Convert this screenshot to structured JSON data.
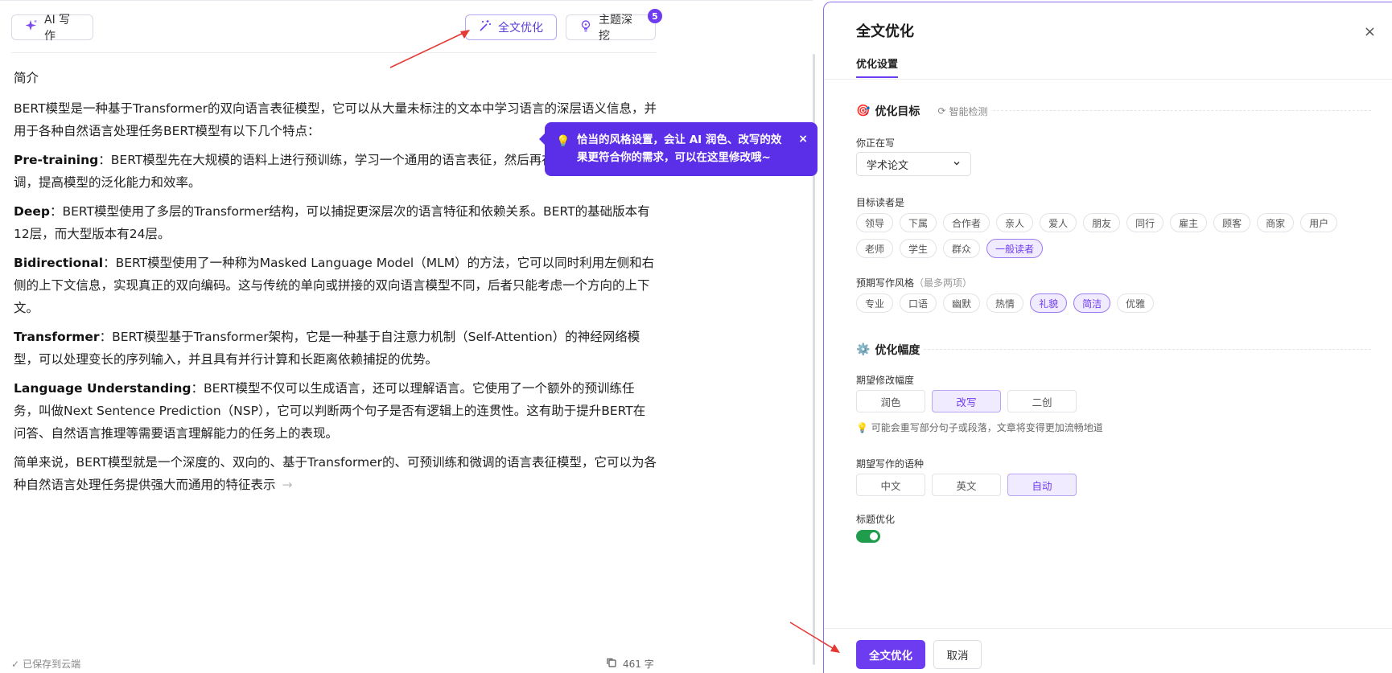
{
  "colors": {
    "accent": "#6d3bf0",
    "tooltip": "#5b2ee8",
    "toggle_on": "#1f9d4c",
    "annotation_arrow": "#e53935"
  },
  "toolbar": {
    "ai_write_label": "AI 写作",
    "optimize_label": "全文优化",
    "topic_label": "主题深挖",
    "topic_badge": "5"
  },
  "article": {
    "heading": "简介",
    "intro": "BERT模型是一种基于Transformer的双向语言表征模型，它可以从大量未标注的文本中学习语言的深层语义信息，并用于各种自然语言处理任务BERT模型有以下几个特点：",
    "items": [
      {
        "term": "Pre-training",
        "text": "：BERT模型先在大规模的语料上进行预训练，学习一个通用的语言表征，然后再在特定任务上进行微调，提高模型的泛化能力和效率。"
      },
      {
        "term": "Deep",
        "text": "：BERT模型使用了多层的Transformer结构，可以捕捉更深层次的语言特征和依赖关系。BERT的基础版本有12层，而大型版本有24层。"
      },
      {
        "term": "Bidirectional",
        "text": "：BERT模型使用了一种称为Masked Language Model（MLM）的方法，它可以同时利用左侧和右侧的上下文信息，实现真正的双向编码。这与传统的单向或拼接的双向语言模型不同，后者只能考虑一个方向的上下文。"
      },
      {
        "term": "Transformer",
        "text": "：BERT模型基于Transformer架构，它是一种基于自注意力机制（Self-Attention）的神经网络模型，可以处理变长的序列输入，并且具有并行计算和长距离依赖捕捉的优势。"
      },
      {
        "term": "Language Understanding",
        "text": "：BERT模型不仅可以生成语言，还可以理解语言。它使用了一个额外的预训练任务，叫做Next Sentence Prediction（NSP），它可以判断两个句子是否有逻辑上的连贯性。这有助于提升BERT在问答、自然语言推理等需要语言理解能力的任务上的表现。"
      }
    ],
    "summary": "简单来说，BERT模型就是一个深度的、双向的、基于Transformer的、可预训练和微调的语言表征模型，它可以为各种自然语言处理任务提供强大而通用的特征表示"
  },
  "footer": {
    "save_status": "已保存到云端",
    "word_count": "461 字"
  },
  "tooltip": {
    "text": "恰当的风格设置，会让 AI 润色、改写的效果更符合你的需求，可以在这里修改哦~",
    "close": "×"
  },
  "panel": {
    "title": "全文优化",
    "close": "×",
    "tab": "优化设置",
    "goal": {
      "title": "优化目标",
      "detect": "智能检测",
      "genre_label": "你正在写",
      "genre_value": "学术论文",
      "audience_label": "目标读者是",
      "audience": [
        {
          "label": "领导",
          "active": false
        },
        {
          "label": "下属",
          "active": false
        },
        {
          "label": "合作者",
          "active": false
        },
        {
          "label": "亲人",
          "active": false
        },
        {
          "label": "爱人",
          "active": false
        },
        {
          "label": "朋友",
          "active": false
        },
        {
          "label": "同行",
          "active": false
        },
        {
          "label": "雇主",
          "active": false
        },
        {
          "label": "顾客",
          "active": false
        },
        {
          "label": "商家",
          "active": false
        },
        {
          "label": "用户",
          "active": false
        },
        {
          "label": "老师",
          "active": false
        },
        {
          "label": "学生",
          "active": false
        },
        {
          "label": "群众",
          "active": false
        },
        {
          "label": "一般读者",
          "active": true
        }
      ],
      "style_label": "预期写作风格",
      "style_hint": "（最多两项）",
      "styles": [
        {
          "label": "专业",
          "active": false
        },
        {
          "label": "口语",
          "active": false
        },
        {
          "label": "幽默",
          "active": false
        },
        {
          "label": "热情",
          "active": false
        },
        {
          "label": "礼貌",
          "active": true
        },
        {
          "label": "简洁",
          "active": true
        },
        {
          "label": "优雅",
          "active": false
        }
      ]
    },
    "range": {
      "title": "优化幅度",
      "label": "期望修改幅度",
      "options": [
        {
          "label": "润色",
          "active": false
        },
        {
          "label": "改写",
          "active": true
        },
        {
          "label": "二创",
          "active": false
        }
      ],
      "hint": "可能会重写部分句子或段落，文章将变得更加流畅地道",
      "lang_label": "期望写作的语种",
      "langs": [
        {
          "label": "中文",
          "active": false
        },
        {
          "label": "英文",
          "active": false
        },
        {
          "label": "自动",
          "active": true
        }
      ],
      "title_opt_label": "标题优化",
      "title_opt_on": true
    },
    "submit": "全文优化",
    "cancel": "取消"
  }
}
